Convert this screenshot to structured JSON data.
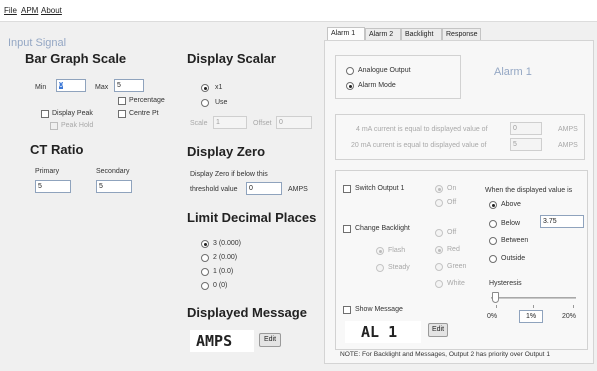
{
  "menu": {
    "file": "File",
    "apm": "APM",
    "about": "About"
  },
  "input_signal": {
    "title": "Input Signal",
    "bar_graph": {
      "title": "Bar Graph Scale",
      "min_label": "Min",
      "min_value": "0",
      "max_label": "Max",
      "max_value": "5",
      "percentage": "Percentage",
      "display_peak": "Display Peak",
      "centre_pt": "Centre Pt",
      "peak_hold": "Peak Hold"
    },
    "ct_ratio": {
      "title": "CT Ratio",
      "primary_label": "Primary",
      "primary_value": "5",
      "secondary_label": "Secondary",
      "secondary_value": "5"
    }
  },
  "display_scalar": {
    "title": "Display Scalar",
    "x1": "x1",
    "use": "Use",
    "scale_label": "Scale",
    "scale_value": "1",
    "offset_label": "Offset",
    "offset_value": "0"
  },
  "display_zero": {
    "title": "Display Zero",
    "line1": "Display Zero if below this",
    "line2": "threshold value",
    "value": "0",
    "unit": "AMPS"
  },
  "limit_decimal": {
    "title": "Limit Decimal Places",
    "options": [
      "3 (0.000)",
      "2 (0.00)",
      "1 (0.0)",
      "0 (0)"
    ]
  },
  "displayed_message": {
    "title": "Displayed Message",
    "text": "AMPS",
    "edit": "Edit"
  },
  "tabs": [
    "Alarm 1",
    "Alarm 2",
    "Backlight",
    "Response"
  ],
  "alarm": {
    "analogue_output": "Analogue Output",
    "alarm_mode": "Alarm Mode",
    "title": "Alarm 1",
    "ma4_text": "4 mA current is equal to displayed value of",
    "ma4_value": "0",
    "ma20_text": "20 mA current is equal to displayed value of",
    "ma20_value": "5",
    "amps": "AMPS",
    "switch_output": "Switch Output 1",
    "on": "On",
    "off": "Off",
    "change_backlight": "Change Backlight",
    "flash": "Flash",
    "steady": "Steady",
    "bl_off": "Off",
    "red": "Red",
    "green": "Green",
    "white": "White",
    "when_label": "When the displayed value is",
    "above": "Above",
    "below": "Below",
    "below_value": "3.75",
    "between": "Between",
    "outside": "Outside",
    "hysteresis": "Hysteresis",
    "hys_min": "0%",
    "hys_value": "1%",
    "hys_max": "20%",
    "show_message": "Show Message",
    "message_text": "AL 1",
    "edit": "Edit",
    "note": "NOTE: For Backlight and Messages, Output 2 has priority over Output 1"
  }
}
